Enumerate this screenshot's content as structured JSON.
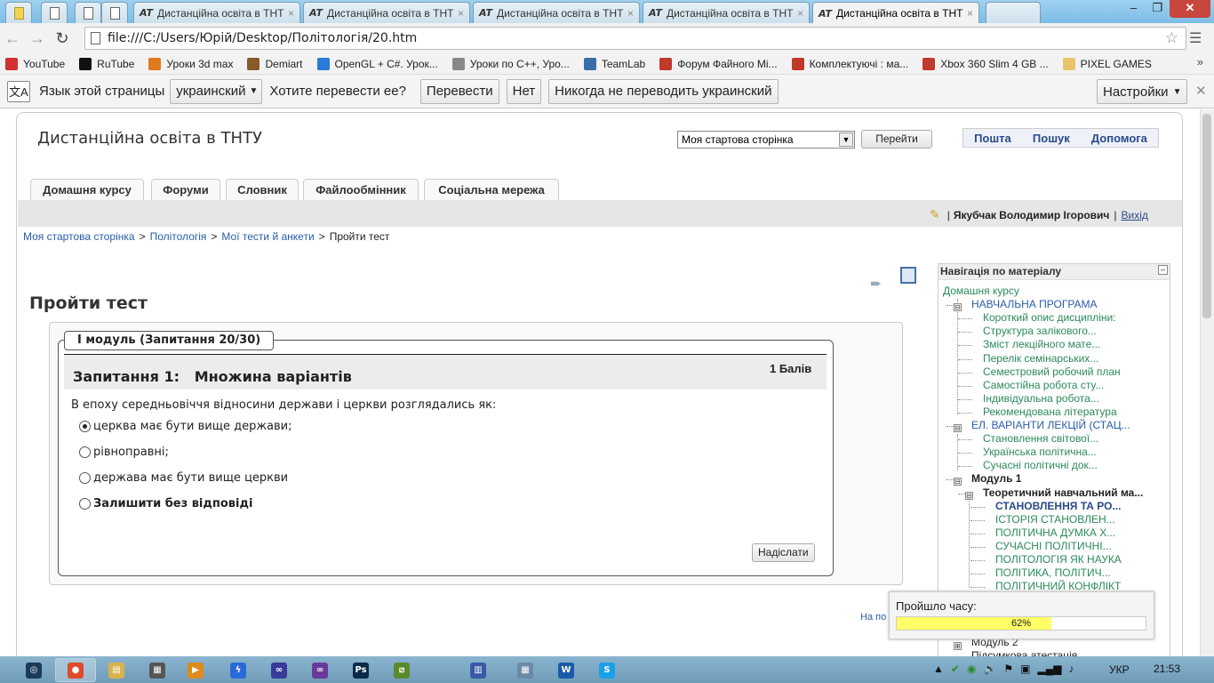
{
  "browser": {
    "tabs": [
      {
        "label": "",
        "pinned": true
      },
      {
        "label": "",
        "pinned": true
      },
      {
        "label": "",
        "pinned": true
      },
      {
        "label": "",
        "pinned": true
      },
      {
        "label": "Дистанційна освіта в ТНТ",
        "pinned": false
      },
      {
        "label": "Дистанційна освіта в ТНТ",
        "pinned": false
      },
      {
        "label": "Дистанційна освіта в ТНТ",
        "pinned": false
      },
      {
        "label": "Дистанційна освіта в ТНТ",
        "pinned": false
      },
      {
        "label": "Дистанційна освіта в ТНТ",
        "pinned": false,
        "active": true
      }
    ],
    "tab_favicon": "AT",
    "tab_close": "×",
    "url": "file:///C:/Users/Юрій/Desktop/Політологія/20.htm",
    "window_controls": {
      "minimize": "–",
      "restore": "❐",
      "close": "✕"
    }
  },
  "bookmarks": [
    {
      "label": "YouTube",
      "icon": "youtube-icon",
      "color": "#d32f2f"
    },
    {
      "label": "RuTube",
      "icon": "rutube-icon",
      "color": "#111111"
    },
    {
      "label": "Уроки 3d max",
      "icon": "3dmax-icon",
      "color": "#e07a1f"
    },
    {
      "label": "Demiart",
      "icon": "demiart-icon",
      "color": "#8a5a2b"
    },
    {
      "label": "OpenGL + C#. Урок...",
      "icon": "check-icon",
      "color": "#2a7ad8"
    },
    {
      "label": "Уроки по C++, Уро...",
      "icon": "page-icon",
      "color": "#888888"
    },
    {
      "label": "TeamLab",
      "icon": "teamlab-icon",
      "color": "#3a6ea8"
    },
    {
      "label": "Форум Файного Мі...",
      "icon": "forum-icon",
      "color": "#c0392b"
    },
    {
      "label": "Комплектуючі : ма...",
      "icon": "forum-icon",
      "color": "#c0392b"
    },
    {
      "label": "Xbox 360 Slim 4 GB ...",
      "icon": "forum-icon",
      "color": "#c0392b"
    },
    {
      "label": "PIXEL GAMES",
      "icon": "folder-icon",
      "color": "#e8c46a"
    }
  ],
  "translate_bar": {
    "prompt": "Язык этой страницы",
    "language": "украинский",
    "question": "Хотите перевести ее?",
    "translate": "Перевести",
    "no": "Нет",
    "never": "Никогда не переводить украинский",
    "settings": "Настройки"
  },
  "site": {
    "name": "Дистанційна освіта в ТНТУ",
    "jump_select": "Моя стартова сторінка",
    "jump_go": "Перейти",
    "header_links": [
      "Пошта",
      "Пошук",
      "Допомога"
    ],
    "course_tabs": [
      "Домашня курсу",
      "Форуми",
      "Словник",
      "Файлообмінник",
      "Соціальна мережа"
    ],
    "user_name": "Якубчак Володимир Ігорович",
    "logout": "Вихід",
    "breadcrumb": [
      "Моя стартова сторінка",
      "Політологія",
      "Мої тести й анкети",
      "Пройти тест"
    ],
    "breadcrumb_sep": ">",
    "page_title": "Пройти тест"
  },
  "quiz": {
    "legend": "I модуль (Запитання 20/30)",
    "question_title": "Запитання 1:   Множина варіантів",
    "mark": "1 Балів",
    "question_text": "В епоху середньовіччя відносини держави і церкви розглядались як:",
    "options": [
      {
        "label": "церква має бути вище держави;",
        "selected": true,
        "bold": false
      },
      {
        "label": "рівноправні;",
        "selected": false,
        "bold": false
      },
      {
        "label": "держава має бути вище церкви",
        "selected": false,
        "bold": false
      },
      {
        "label": "Залишити без відповіді",
        "selected": false,
        "bold": true
      }
    ],
    "submit": "Надіслати",
    "bottom_link": "На по"
  },
  "side_nav": {
    "title": "Навігація по матеріалу",
    "items": [
      {
        "label": "Домашня курсу",
        "level": 0,
        "style": "link"
      },
      {
        "label": "НАВЧАЛЬНА ПРОГРАМА",
        "level": 1,
        "style": "head",
        "toggle": "⊟"
      },
      {
        "label": "Короткий опис дисципліни:",
        "level": 2,
        "style": "link"
      },
      {
        "label": "Структура залікового...",
        "level": 2,
        "style": "link"
      },
      {
        "label": "Зміст лекційного мате...",
        "level": 2,
        "style": "link"
      },
      {
        "label": "Перелік семінарських...",
        "level": 2,
        "style": "link"
      },
      {
        "label": "Семестровий робочий план",
        "level": 2,
        "style": "link"
      },
      {
        "label": "Самостійна робота сту...",
        "level": 2,
        "style": "link"
      },
      {
        "label": "Індивідуальна робота...",
        "level": 2,
        "style": "link"
      },
      {
        "label": "Рекомендована література",
        "level": 2,
        "style": "link"
      },
      {
        "label": "ЕЛ. ВАРІАНТИ ЛЕКЦІЙ (СТАЦ...",
        "level": 1,
        "style": "head",
        "toggle": "⊟"
      },
      {
        "label": "Становлення світової...",
        "level": 2,
        "style": "link"
      },
      {
        "label": "Українська політична...",
        "level": 2,
        "style": "link"
      },
      {
        "label": "Сучасні політичні док...",
        "level": 2,
        "style": "link"
      },
      {
        "label": "Модуль 1",
        "level": 1,
        "style": "bold",
        "toggle": "⊟"
      },
      {
        "label": "Теоретичний навчальний ма...",
        "level": 2,
        "style": "bold",
        "toggle": "⊟"
      },
      {
        "label": "СТАНОВЛЕННЯ ТА РО...",
        "level": 3,
        "style": "current"
      },
      {
        "label": "ІСТОРІЯ СТАНОВЛЕН...",
        "level": 3,
        "style": "link"
      },
      {
        "label": "ПОЛІТИЧНА ДУМКА Х...",
        "level": 3,
        "style": "link"
      },
      {
        "label": "СУЧАСНІ ПОЛІТИЧНІ...",
        "level": 3,
        "style": "link"
      },
      {
        "label": "ПОЛІТОЛОГІЯ ЯК НАУКА",
        "level": 3,
        "style": "link"
      },
      {
        "label": "ПОЛІТИКА, ПОЛІТИЧ...",
        "level": 3,
        "style": "link"
      },
      {
        "label": "ПОЛІТИЧНИЙ КОНФЛІКТ",
        "level": 3,
        "style": "link"
      }
    ],
    "module2": "Модуль 2",
    "module2_toggle": "⊞",
    "final": "Підсумкова атестація"
  },
  "timer": {
    "label": "Пройшло часу:",
    "percent_text": "62%",
    "fraction": 0.62
  },
  "taskbar": {
    "apps": [
      {
        "icon": "explorer-ball-icon",
        "glyph": "◎",
        "color": "#1a3a5a"
      },
      {
        "icon": "chrome-icon",
        "glyph": "●",
        "color": "#e04a2a"
      },
      {
        "icon": "folder-icon",
        "glyph": "▤",
        "color": "#d8b34a"
      },
      {
        "icon": "film-icon",
        "glyph": "▦",
        "color": "#555555"
      },
      {
        "icon": "media-player-icon",
        "glyph": "▶",
        "color": "#e08a1a"
      },
      {
        "icon": "lightning-icon",
        "glyph": "ϟ",
        "color": "#2a6ad8"
      },
      {
        "icon": "mask-icon",
        "glyph": "∞",
        "color": "#3a3a9a"
      },
      {
        "icon": "visual-studio-icon",
        "glyph": "∞",
        "color": "#6a3a9a"
      },
      {
        "icon": "photoshop-icon",
        "glyph": "Ps",
        "color": "#0a2a4a"
      },
      {
        "icon": "excel-like-icon",
        "glyph": "⧄",
        "color": "#5a8a2a"
      },
      {
        "icon": "text-editor-icon",
        "glyph": "▥",
        "color": "#3a5aa8"
      },
      {
        "icon": "calculator-icon",
        "glyph": "▦",
        "color": "#6a8aa8"
      },
      {
        "icon": "word-icon",
        "glyph": "W",
        "color": "#1a5aa8"
      },
      {
        "icon": "skype-icon",
        "glyph": "S",
        "color": "#1aa0e8"
      }
    ],
    "language": "УКР",
    "time": "21:53"
  }
}
